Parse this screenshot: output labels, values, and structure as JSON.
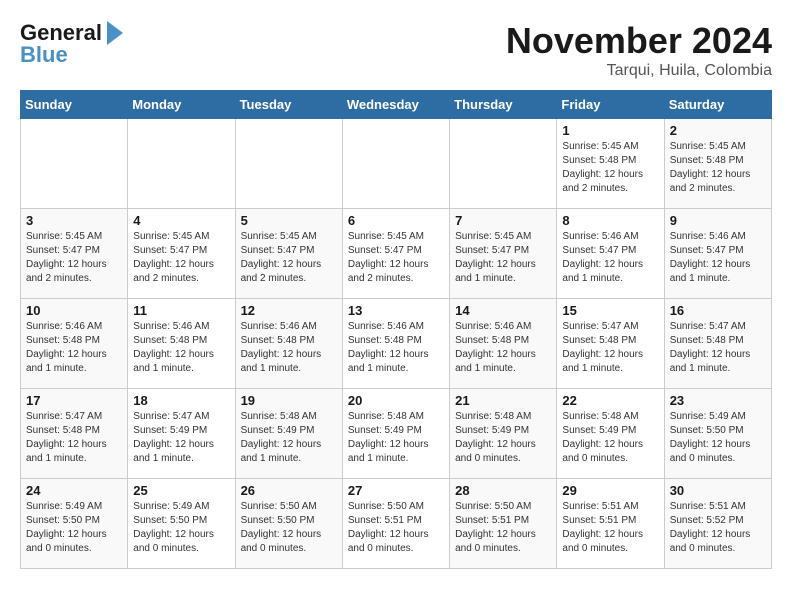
{
  "logo": {
    "line1": "General",
    "line2": "Blue"
  },
  "title": "November 2024",
  "location": "Tarqui, Huila, Colombia",
  "headers": [
    "Sunday",
    "Monday",
    "Tuesday",
    "Wednesday",
    "Thursday",
    "Friday",
    "Saturday"
  ],
  "weeks": [
    [
      {
        "day": "",
        "info": ""
      },
      {
        "day": "",
        "info": ""
      },
      {
        "day": "",
        "info": ""
      },
      {
        "day": "",
        "info": ""
      },
      {
        "day": "",
        "info": ""
      },
      {
        "day": "1",
        "info": "Sunrise: 5:45 AM\nSunset: 5:48 PM\nDaylight: 12 hours\nand 2 minutes."
      },
      {
        "day": "2",
        "info": "Sunrise: 5:45 AM\nSunset: 5:48 PM\nDaylight: 12 hours\nand 2 minutes."
      }
    ],
    [
      {
        "day": "3",
        "info": "Sunrise: 5:45 AM\nSunset: 5:47 PM\nDaylight: 12 hours\nand 2 minutes."
      },
      {
        "day": "4",
        "info": "Sunrise: 5:45 AM\nSunset: 5:47 PM\nDaylight: 12 hours\nand 2 minutes."
      },
      {
        "day": "5",
        "info": "Sunrise: 5:45 AM\nSunset: 5:47 PM\nDaylight: 12 hours\nand 2 minutes."
      },
      {
        "day": "6",
        "info": "Sunrise: 5:45 AM\nSunset: 5:47 PM\nDaylight: 12 hours\nand 2 minutes."
      },
      {
        "day": "7",
        "info": "Sunrise: 5:45 AM\nSunset: 5:47 PM\nDaylight: 12 hours\nand 1 minute."
      },
      {
        "day": "8",
        "info": "Sunrise: 5:46 AM\nSunset: 5:47 PM\nDaylight: 12 hours\nand 1 minute."
      },
      {
        "day": "9",
        "info": "Sunrise: 5:46 AM\nSunset: 5:47 PM\nDaylight: 12 hours\nand 1 minute."
      }
    ],
    [
      {
        "day": "10",
        "info": "Sunrise: 5:46 AM\nSunset: 5:48 PM\nDaylight: 12 hours\nand 1 minute."
      },
      {
        "day": "11",
        "info": "Sunrise: 5:46 AM\nSunset: 5:48 PM\nDaylight: 12 hours\nand 1 minute."
      },
      {
        "day": "12",
        "info": "Sunrise: 5:46 AM\nSunset: 5:48 PM\nDaylight: 12 hours\nand 1 minute."
      },
      {
        "day": "13",
        "info": "Sunrise: 5:46 AM\nSunset: 5:48 PM\nDaylight: 12 hours\nand 1 minute."
      },
      {
        "day": "14",
        "info": "Sunrise: 5:46 AM\nSunset: 5:48 PM\nDaylight: 12 hours\nand 1 minute."
      },
      {
        "day": "15",
        "info": "Sunrise: 5:47 AM\nSunset: 5:48 PM\nDaylight: 12 hours\nand 1 minute."
      },
      {
        "day": "16",
        "info": "Sunrise: 5:47 AM\nSunset: 5:48 PM\nDaylight: 12 hours\nand 1 minute."
      }
    ],
    [
      {
        "day": "17",
        "info": "Sunrise: 5:47 AM\nSunset: 5:48 PM\nDaylight: 12 hours\nand 1 minute."
      },
      {
        "day": "18",
        "info": "Sunrise: 5:47 AM\nSunset: 5:49 PM\nDaylight: 12 hours\nand 1 minute."
      },
      {
        "day": "19",
        "info": "Sunrise: 5:48 AM\nSunset: 5:49 PM\nDaylight: 12 hours\nand 1 minute."
      },
      {
        "day": "20",
        "info": "Sunrise: 5:48 AM\nSunset: 5:49 PM\nDaylight: 12 hours\nand 1 minute."
      },
      {
        "day": "21",
        "info": "Sunrise: 5:48 AM\nSunset: 5:49 PM\nDaylight: 12 hours\nand 0 minutes."
      },
      {
        "day": "22",
        "info": "Sunrise: 5:48 AM\nSunset: 5:49 PM\nDaylight: 12 hours\nand 0 minutes."
      },
      {
        "day": "23",
        "info": "Sunrise: 5:49 AM\nSunset: 5:50 PM\nDaylight: 12 hours\nand 0 minutes."
      }
    ],
    [
      {
        "day": "24",
        "info": "Sunrise: 5:49 AM\nSunset: 5:50 PM\nDaylight: 12 hours\nand 0 minutes."
      },
      {
        "day": "25",
        "info": "Sunrise: 5:49 AM\nSunset: 5:50 PM\nDaylight: 12 hours\nand 0 minutes."
      },
      {
        "day": "26",
        "info": "Sunrise: 5:50 AM\nSunset: 5:50 PM\nDaylight: 12 hours\nand 0 minutes."
      },
      {
        "day": "27",
        "info": "Sunrise: 5:50 AM\nSunset: 5:51 PM\nDaylight: 12 hours\nand 0 minutes."
      },
      {
        "day": "28",
        "info": "Sunrise: 5:50 AM\nSunset: 5:51 PM\nDaylight: 12 hours\nand 0 minutes."
      },
      {
        "day": "29",
        "info": "Sunrise: 5:51 AM\nSunset: 5:51 PM\nDaylight: 12 hours\nand 0 minutes."
      },
      {
        "day": "30",
        "info": "Sunrise: 5:51 AM\nSunset: 5:52 PM\nDaylight: 12 hours\nand 0 minutes."
      }
    ]
  ]
}
